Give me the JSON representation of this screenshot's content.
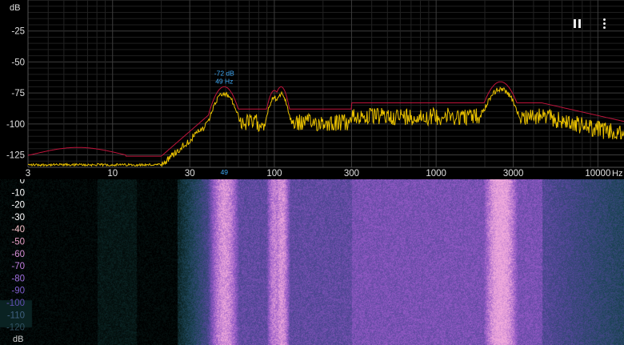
{
  "spectrum": {
    "y_unit": "dB",
    "x_unit": "Hz",
    "y_ticks": [
      "-25",
      "-50",
      "-75",
      "-100",
      "-125"
    ],
    "y_tick_values": [
      -25,
      -50,
      -75,
      -100,
      -125
    ],
    "x_ticks": [
      "3",
      "10",
      "30",
      "100",
      "300",
      "1000",
      "3000",
      "10000"
    ],
    "x_tick_values": [
      3,
      10,
      30,
      100,
      300,
      1000,
      3000,
      10000
    ],
    "peak": {
      "db_label": "-72 dB",
      "hz_label": "49 Hz",
      "axis_marker": "49",
      "freq": 49,
      "db": -72
    },
    "colors": {
      "peak_hold": "#c0143c",
      "live": "#e8c000",
      "grid": "#3a3a3a",
      "label": "#e0e0e0",
      "peak_label": "#3fa9f5"
    }
  },
  "spectrogram": {
    "db_ticks": [
      "0",
      "-10",
      "-20",
      "-30",
      "-40",
      "-50",
      "-60",
      "-70",
      "-80",
      "-90",
      "-100",
      "-110",
      "-120"
    ],
    "db_tick_colors": [
      "#ffffff",
      "#ffffff",
      "#ffffff",
      "#ffffff",
      "#f5c0c8",
      "#e8a0c8",
      "#d890d8",
      "#c080e0",
      "#a070e0",
      "#8060d0",
      "#6050b0",
      "#406080",
      "#305060"
    ],
    "unit": "dB"
  },
  "controls": {
    "pause_icon": "pause-icon",
    "menu_icon": "more-vertical-icon"
  }
}
